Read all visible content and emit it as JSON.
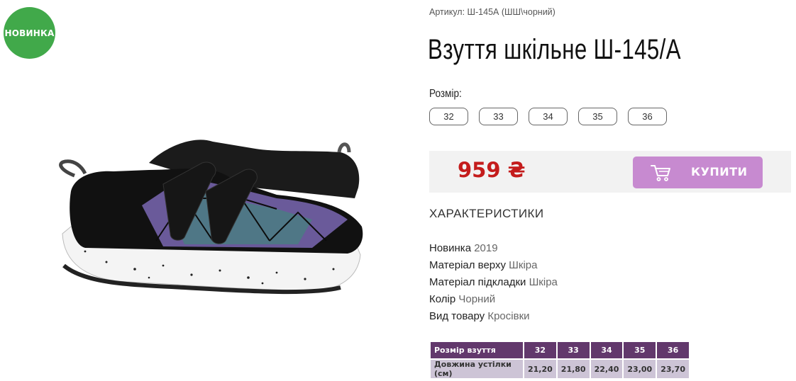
{
  "badge": {
    "label": "НОВИНКА",
    "color": "#41a94a"
  },
  "product": {
    "sku": "Артикул: Ш-145А (ШШ\\чорний)",
    "title": "Взуття шкільне Ш-145/А",
    "image_alt": "Black school sneakers with holographic triangle pattern and velcro straps"
  },
  "sizes": {
    "label": "Розмір:",
    "options": [
      "32",
      "33",
      "34",
      "35",
      "36"
    ]
  },
  "purchase": {
    "price": "959 ₴",
    "price_color": "#c41c1c",
    "buy_label": "КУПИТИ",
    "buy_color": "#c78ad0",
    "buy_icon": "cart-icon"
  },
  "characteristics": {
    "heading": "ХАРАКТЕРИСТИКИ",
    "items": [
      {
        "key": "Новинка",
        "value": "2019"
      },
      {
        "key": "Матеріал верху",
        "value": "Шкіра"
      },
      {
        "key": "Матеріал підкладки",
        "value": "Шкіра"
      },
      {
        "key": "Колір",
        "value": "Чорний"
      },
      {
        "key": "Вид товару",
        "value": "Кросівки"
      }
    ]
  },
  "size_table": {
    "header": [
      "Розмір взуття",
      "32",
      "33",
      "34",
      "35",
      "36"
    ],
    "row": [
      "Довжина устілки (см)",
      "21,20",
      "21,80",
      "22,40",
      "23,00",
      "23,70"
    ],
    "header_color": "#62386c",
    "row_color": "#cdc4d6"
  }
}
